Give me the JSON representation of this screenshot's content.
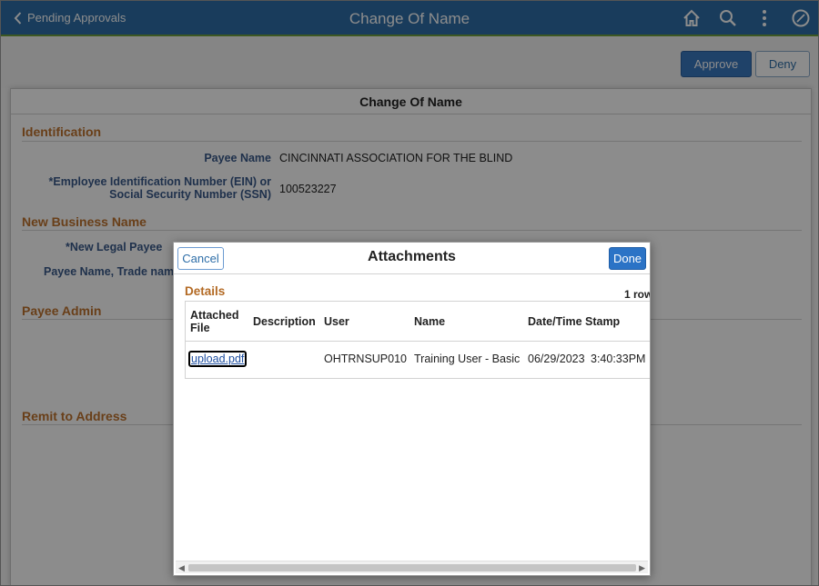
{
  "banner": {
    "back_label": "Pending Approvals",
    "title": "Change Of Name",
    "icons": [
      "home-icon",
      "search-icon",
      "more-vertical-icon",
      "navigator-icon"
    ],
    "bg_color": "#2e6ea8"
  },
  "toolbar": {
    "approve_label": "Approve",
    "deny_label": "Deny"
  },
  "panel": {
    "title": "Change Of Name",
    "identification": {
      "title": "Identification",
      "payee_name_label": "Payee Name",
      "payee_name_value": "CINCINNATI ASSOCIATION FOR THE BLIND",
      "ein_label_line1": "*Employee Identification Number (EIN) or",
      "ein_label_line2": "Social Security Number (SSN)",
      "ein_value": "100523227"
    },
    "new_business": {
      "title": "New Business Name",
      "legal_payee_label": "*New Legal Payee",
      "trade_name_label": "Payee Name, Trade nam"
    },
    "payee_admin_title": "Payee Admin",
    "remit_title": "Remit to Address"
  },
  "modal": {
    "title": "Attachments",
    "cancel_label": "Cancel",
    "done_label": "Done",
    "details_title": "Details",
    "row_count": "1 row",
    "columns": {
      "file_line1": "Attached",
      "file_line2": "File",
      "description": "Description",
      "user": "User",
      "name": "Name",
      "datetime": "Date/Time Stamp"
    },
    "row": {
      "file": "upload.pdf",
      "description": "",
      "user": "OHTRNSUP010",
      "name": "Training User - Basic",
      "date": "06/29/2023",
      "time": "3:40:33PM"
    }
  }
}
